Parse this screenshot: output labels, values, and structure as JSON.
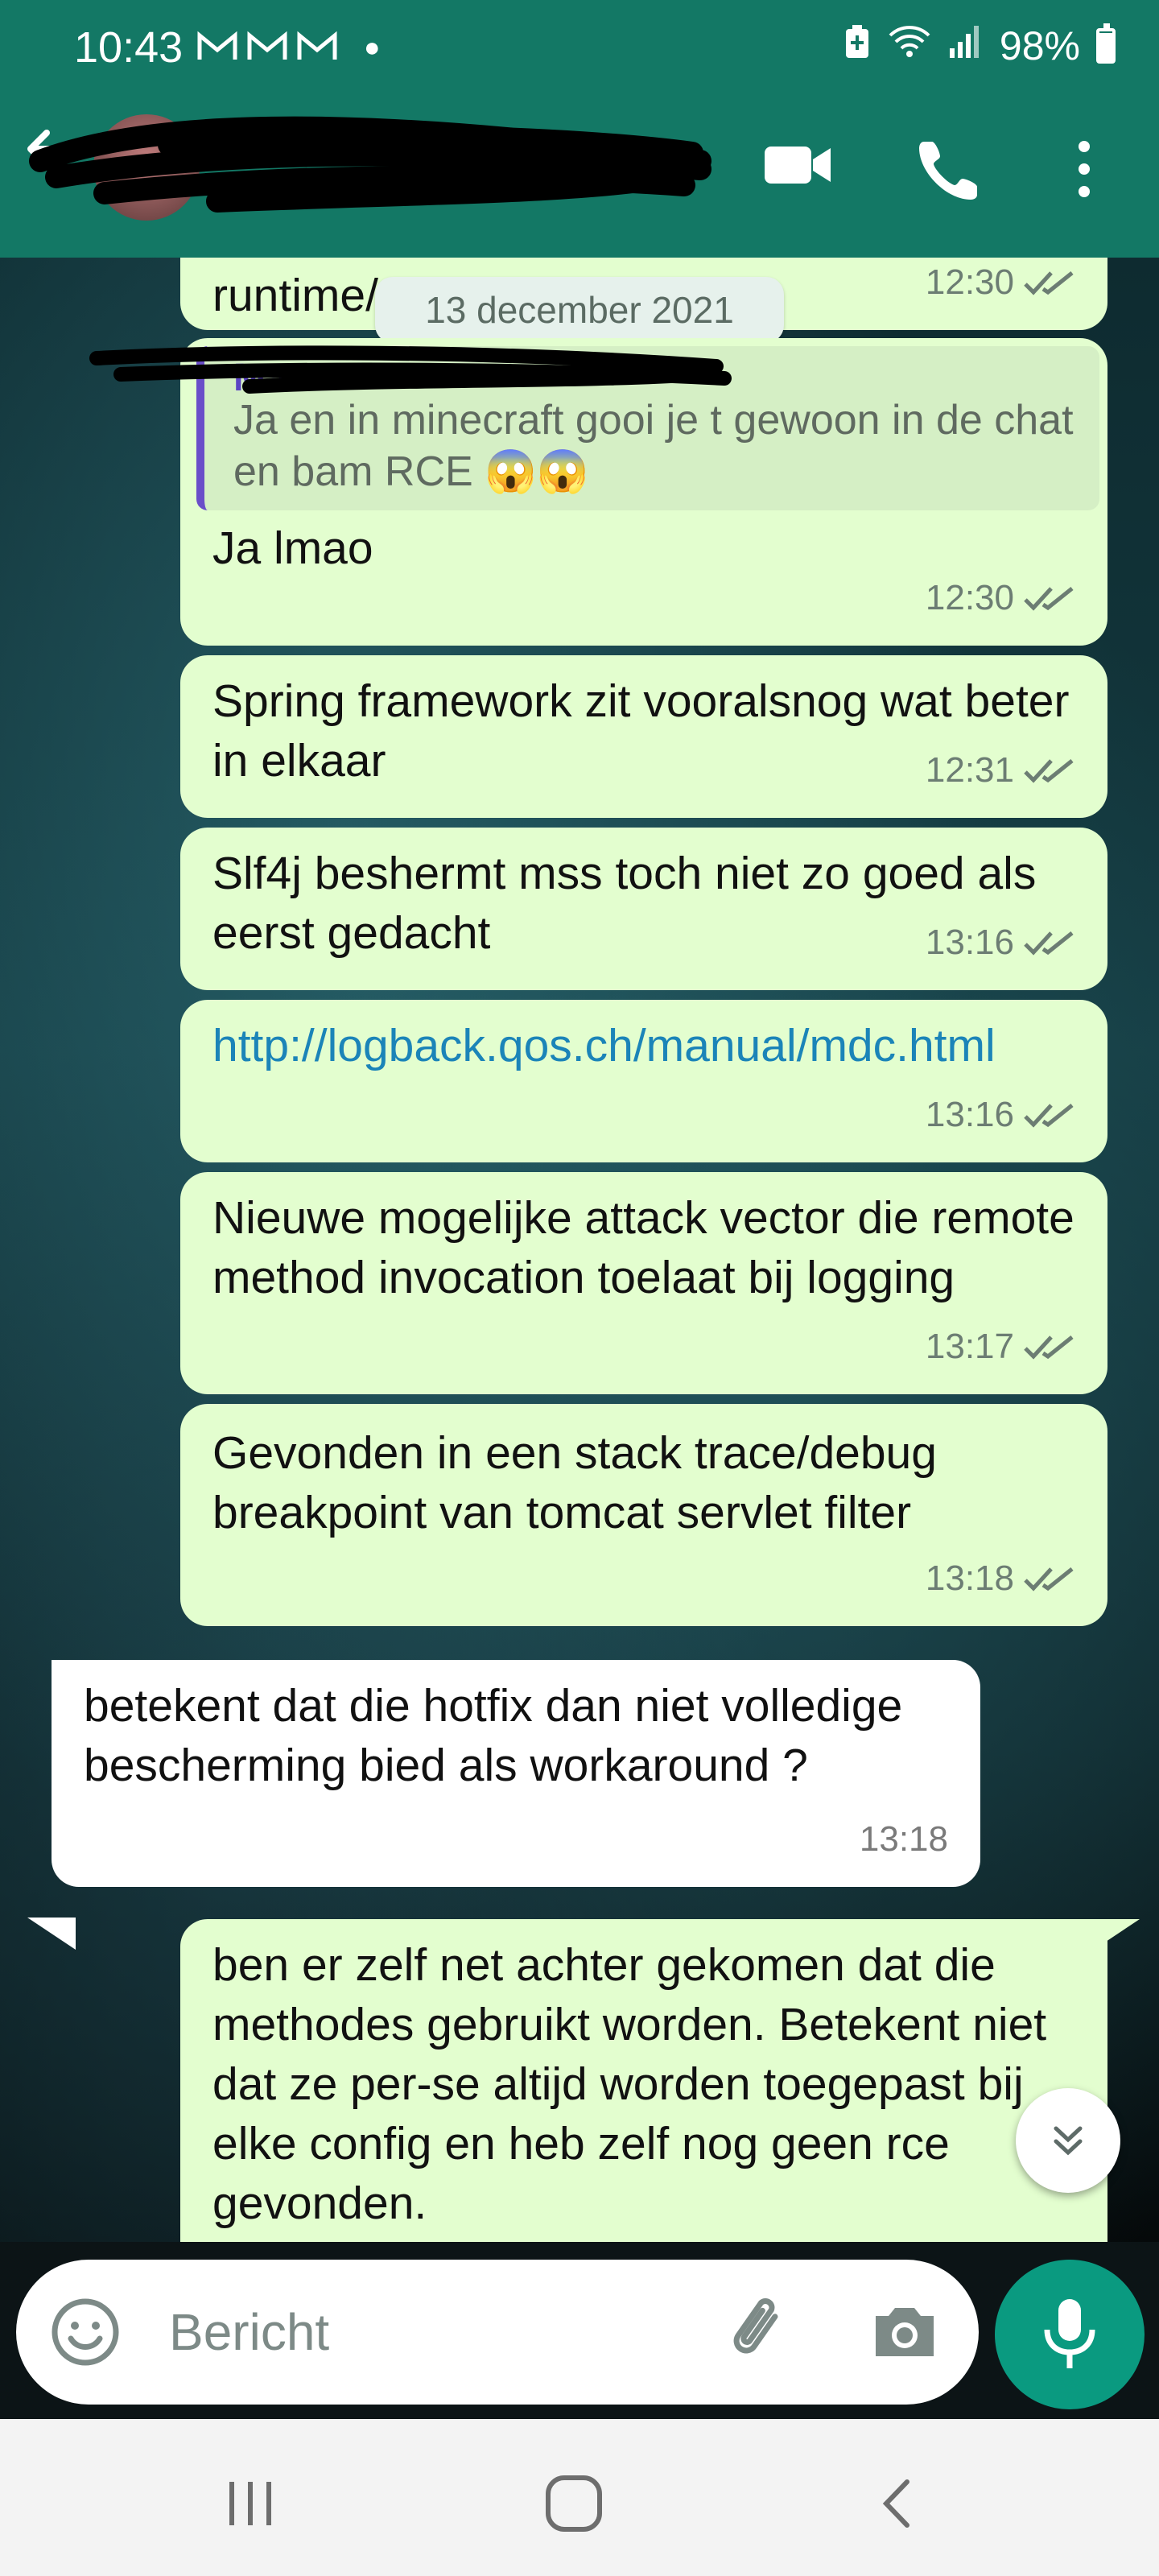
{
  "status_bar": {
    "time": "10:43",
    "notif_icons": [
      "gmail-icon",
      "gmail-icon",
      "gmail-icon"
    ],
    "battery": "98%"
  },
  "header": {
    "contact_name": "",
    "icons": [
      "back-arrow-icon",
      "video-call-icon",
      "voice-call-icon",
      "more-options-icon"
    ]
  },
  "chat": {
    "date_chip": "13 december 2021",
    "messages": [
      {
        "dir": "out",
        "text": "runtime/of accs toevoegen",
        "time": "12:30"
      },
      {
        "dir": "out",
        "quote_author": "Ma",
        "quote_text": "Ja en in minecraft gooi je t gewoon in de chat en bam RCE 😱😱",
        "text": "Ja lmao",
        "time": "12:30"
      },
      {
        "dir": "out",
        "text": "Spring framework zit vooralsnog wat beter in elkaar",
        "time": "12:31"
      },
      {
        "dir": "out",
        "text": "Slf4j beshermt mss toch niet zo goed als eerst gedacht",
        "time": "13:16"
      },
      {
        "dir": "out",
        "text": "http://logback.qos.ch/manual/mdc.html",
        "time": "13:16",
        "is_link": true
      },
      {
        "dir": "out",
        "text": "Nieuwe mogelijke attack vector die remote method invocation toelaat bij logging",
        "time": "13:17"
      },
      {
        "dir": "out",
        "text": "Gevonden in een stack trace/debug breakpoint van tomcat servlet filter",
        "time": "13:18"
      },
      {
        "dir": "in",
        "text": "betekent dat die hotfix dan niet volledige bescherming bied als workaround ?",
        "time": "13:18"
      },
      {
        "dir": "out",
        "text": "ben er zelf net achter gekomen dat die methodes gebruikt worden. Betekent niet dat ze per-se altijd worden toegepast bij elke config en heb zelf nog geen rce gevonden."
      }
    ]
  },
  "composer": {
    "placeholder": "Bericht",
    "icons": [
      "emoji-icon",
      "attach-icon",
      "camera-icon",
      "mic-icon"
    ]
  },
  "nav": {
    "icons": [
      "recent-apps-icon",
      "home-icon",
      "back-icon"
    ]
  },
  "colors": {
    "header": "#137865",
    "outgoing_bubble": "#e3fecf",
    "incoming_bubble": "#ffffff",
    "accent_green": "#0a9a80",
    "link": "#1b84b8",
    "quote_bar": "#6a4ec9"
  }
}
